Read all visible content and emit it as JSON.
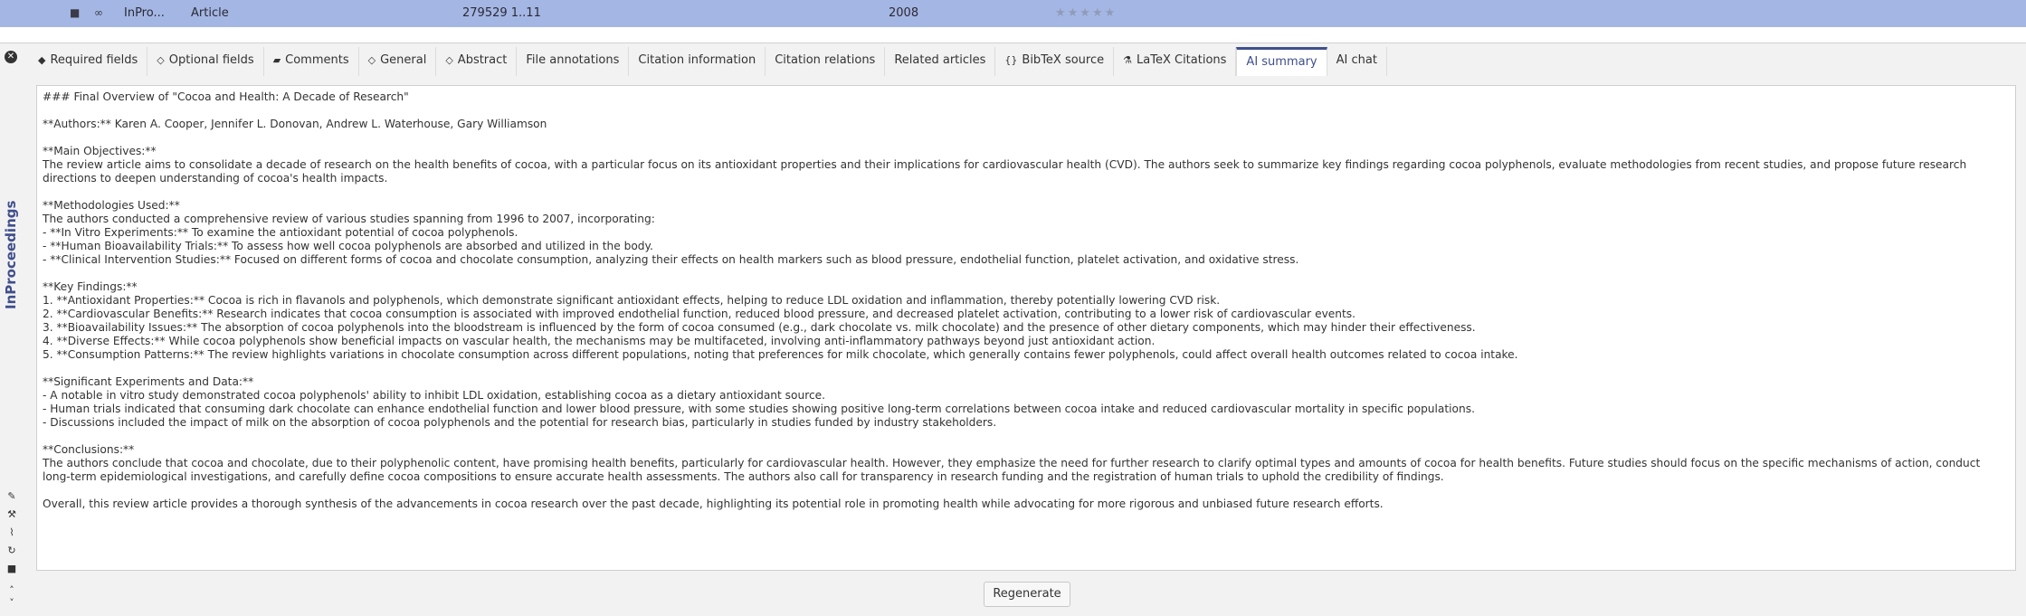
{
  "entry_row": {
    "type_short": "InPro...",
    "entrytype": "Article",
    "pages": "279529 1..11",
    "year": "2008",
    "stars": "★★★★★"
  },
  "side_label": "InProceedings",
  "tabs": [
    {
      "label": "Required fields",
      "icon": "tag-icon"
    },
    {
      "label": "Optional fields",
      "icon": "tag-outline-icon"
    },
    {
      "label": "Comments",
      "icon": "comment-icon"
    },
    {
      "label": "General",
      "icon": "tag-outline-icon"
    },
    {
      "label": "Abstract",
      "icon": "tag-outline-icon"
    },
    {
      "label": "File annotations"
    },
    {
      "label": "Citation information"
    },
    {
      "label": "Citation relations"
    },
    {
      "label": "Related articles"
    },
    {
      "label": "BibTeX source",
      "icon": "braces-icon"
    },
    {
      "label": "LaTeX Citations",
      "icon": "latex-icon"
    },
    {
      "label": "AI summary",
      "active": true
    },
    {
      "label": "AI chat"
    }
  ],
  "summary": [
    "### Final Overview of \"Cocoa and Health: A Decade of Research\"",
    "",
    "**Authors:** Karen A. Cooper, Jennifer L. Donovan, Andrew L. Waterhouse, Gary Williamson",
    "",
    "**Main Objectives:**",
    "The review article aims to consolidate a decade of research on the health benefits of cocoa, with a particular focus on its antioxidant properties and their implications for cardiovascular health (CVD). The authors seek to summarize key findings regarding cocoa polyphenols, evaluate methodologies from recent studies, and propose future research directions to deepen understanding of cocoa's health impacts.",
    "",
    "**Methodologies Used:**",
    "The authors conducted a comprehensive review of various studies spanning from 1996 to 2007, incorporating:",
    "- **In Vitro Experiments:** To examine the antioxidant potential of cocoa polyphenols.",
    "- **Human Bioavailability Trials:** To assess how well cocoa polyphenols are absorbed and utilized in the body.",
    "- **Clinical Intervention Studies:** Focused on different forms of cocoa and chocolate consumption, analyzing their effects on health markers such as blood pressure, endothelial function, platelet activation, and oxidative stress.",
    "",
    "**Key Findings:**",
    "1. **Antioxidant Properties:** Cocoa is rich in flavanols and polyphenols, which demonstrate significant antioxidant effects, helping to reduce LDL oxidation and inflammation, thereby potentially lowering CVD risk.",
    "2. **Cardiovascular Benefits:** Research indicates that cocoa consumption is associated with improved endothelial function, reduced blood pressure, and decreased platelet activation, contributing to a lower risk of cardiovascular events.",
    "3. **Bioavailability Issues:** The absorption of cocoa polyphenols into the bloodstream is influenced by the form of cocoa consumed (e.g., dark chocolate vs. milk chocolate) and the presence of other dietary components, which may hinder their effectiveness.",
    "4. **Diverse Effects:** While cocoa polyphenols show beneficial impacts on vascular health, the mechanisms may be multifaceted, involving anti-inflammatory pathways beyond just antioxidant action.",
    "5. **Consumption Patterns:** The review highlights variations in chocolate consumption across different populations, noting that preferences for milk chocolate, which generally contains fewer polyphenols, could affect overall health outcomes related to cocoa intake.",
    "",
    "**Significant Experiments and Data:**",
    "- A notable in vitro study demonstrated cocoa polyphenols' ability to inhibit LDL oxidation, establishing cocoa as a dietary antioxidant source.",
    "- Human trials indicated that consuming dark chocolate can enhance endothelial function and lower blood pressure, with some studies showing positive long-term correlations between cocoa intake and reduced cardiovascular mortality in specific populations.",
    "- Discussions included the impact of milk on the absorption of cocoa polyphenols and the potential for research bias, particularly in studies funded by industry stakeholders.",
    "",
    "**Conclusions:**",
    "The authors conclude that cocoa and chocolate, due to their polyphenolic content, have promising health benefits, particularly for cardiovascular health. However, they emphasize the need for further research to clarify optimal types and amounts of cocoa for health benefits. Future studies should focus on the specific mechanisms of action, conduct long-term epidemiological investigations, and carefully define cocoa compositions to ensure accurate health assessments. The authors also call for transparency in research funding and the registration of human trials to uphold the credibility of findings.",
    "",
    "Overall, this review article provides a thorough synthesis of the advancements in cocoa research over the past decade, highlighting its potential role in promoting health while advocating for more rigorous and unbiased future research efforts."
  ],
  "regenerate_label": "Regenerate"
}
